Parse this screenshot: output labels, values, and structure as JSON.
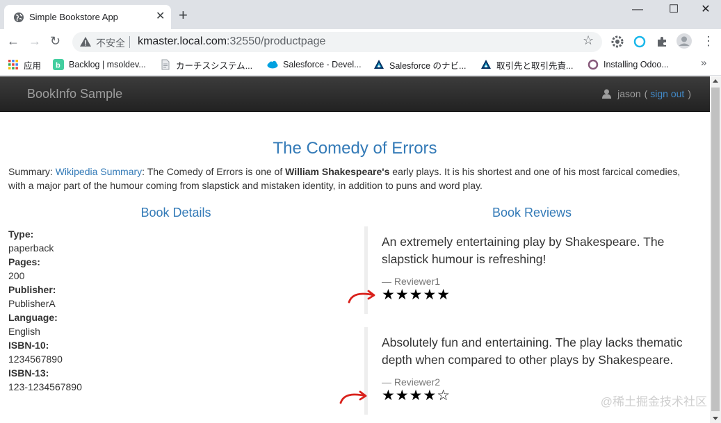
{
  "browser": {
    "tab_title": "Simple Bookstore App",
    "new_tab": "+",
    "close_tab": "✕",
    "url_security": "不安全",
    "url_host": "kmaster.local.com",
    "url_rest": ":32550/productpage",
    "bookmarks": [
      {
        "label": "应用",
        "icon": "apps-grid-icon",
        "color": "#4285f4"
      },
      {
        "label": "Backlog | msoldev...",
        "icon": "backlog-icon",
        "color": "#42ce9f"
      },
      {
        "label": "カーチスシステム...",
        "icon": "document-icon",
        "color": "#9aa0a6"
      },
      {
        "label": "Salesforce - Devel...",
        "icon": "salesforce-cloud-icon",
        "color": "#00a1e0"
      },
      {
        "label": "Salesforce のナビ...",
        "icon": "trailhead-icon",
        "color": "#032d60"
      },
      {
        "label": "取引先と取引先責...",
        "icon": "trailhead-icon",
        "color": "#032d60"
      },
      {
        "label": "Installing Odoo...",
        "icon": "odoo-icon",
        "color": "#875a7b"
      }
    ],
    "bookmarks_more": "»"
  },
  "app": {
    "brand": "BookInfo Sample",
    "user": "jason",
    "paren_open": "(",
    "sign_out": "sign out",
    "paren_close": ")"
  },
  "book": {
    "title": "The Comedy of Errors",
    "summary_prefix": "Summary: ",
    "summary_link": "Wikipedia Summary",
    "summary_text1": ": The Comedy of Errors is one of ",
    "summary_bold": "William Shakespeare's",
    "summary_text2": " early plays. It is his shortest and one of his most farcical comedies, with a major part of the humour coming from slapstick and mistaken identity, in addition to puns and word play."
  },
  "details": {
    "heading": "Book Details",
    "type_label": "Type:",
    "type_value": "paperback",
    "pages_label": "Pages:",
    "pages_value": "200",
    "publisher_label": "Publisher:",
    "publisher_value": "PublisherA",
    "language_label": "Language:",
    "language_value": "English",
    "isbn10_label": "ISBN-10:",
    "isbn10_value": "1234567890",
    "isbn13_label": "ISBN-13:",
    "isbn13_value": "123-1234567890"
  },
  "reviews": {
    "heading": "Book Reviews",
    "items": [
      {
        "text": "An extremely entertaining play by Shakespeare. The slapstick humour is refreshing!",
        "reviewer": "— Reviewer1",
        "stars": "★★★★★",
        "rating": 5
      },
      {
        "text": "Absolutely fun and entertaining. The play lacks thematic depth when compared to other plays by Shakespeare.",
        "reviewer": "— Reviewer2",
        "stars": "★★★★☆",
        "rating": 4
      }
    ],
    "annotation_color": "#d9211b"
  },
  "watermark": "@稀土掘金技术社区"
}
